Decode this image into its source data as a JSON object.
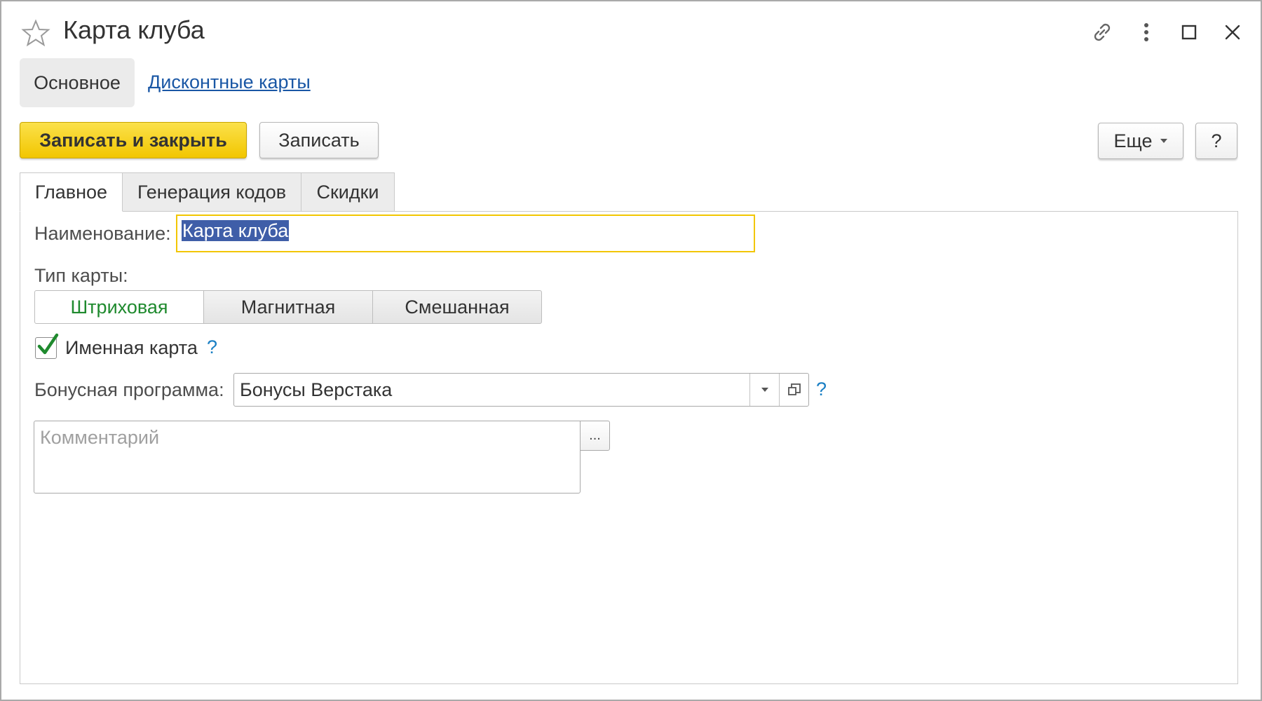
{
  "window": {
    "title": "Карта клуба",
    "icons": [
      "star-icon",
      "link-icon",
      "more-vertical-icon",
      "maximize-icon",
      "close-icon"
    ]
  },
  "nav": {
    "main_label": "Основное",
    "link_label": "Дисконтные карты"
  },
  "toolbar": {
    "save_close_label": "Записать и закрыть",
    "save_label": "Записать",
    "more_label": "Еще",
    "help_label": "?"
  },
  "tabs": [
    {
      "label": "Главное",
      "active": true
    },
    {
      "label": "Генерация кодов",
      "active": false
    },
    {
      "label": "Скидки",
      "active": false
    }
  ],
  "form": {
    "name_label": "Наименование:",
    "name_value": "Карта клуба",
    "card_type_label": "Тип карты:",
    "card_types": [
      {
        "label": "Штриховая",
        "selected": true
      },
      {
        "label": "Магнитная",
        "selected": false
      },
      {
        "label": "Смешанная",
        "selected": false
      }
    ],
    "named_card_label": "Именная карта",
    "named_card_checked": true,
    "help_mark": "?",
    "bonus_label": "Бонусная программа:",
    "bonus_value": "Бонусы Верстака",
    "comment_placeholder": "Комментарий",
    "comment_button_label": "..."
  },
  "colors": {
    "accent_yellow": "#f2c600",
    "link_blue": "#1a57a5",
    "selected_green": "#1f8a2e",
    "help_blue": "#1a7fc4",
    "selection_bg": "#3f5ea8"
  }
}
